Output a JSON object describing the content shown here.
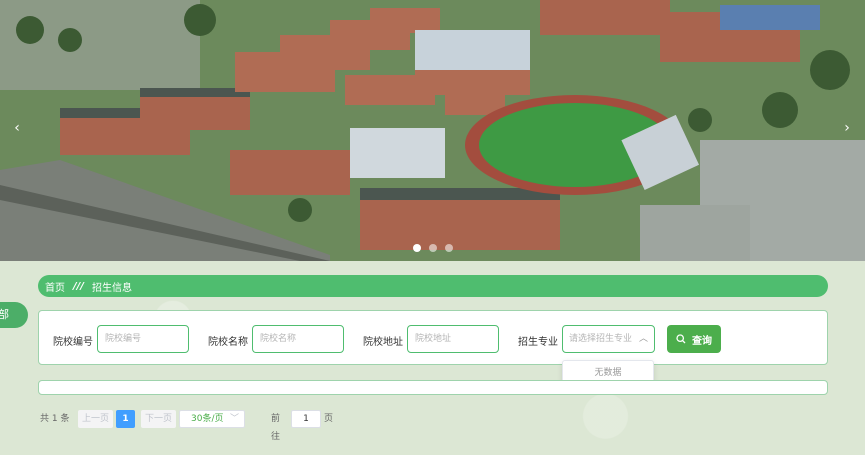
{
  "banner": {
    "prev_arrow": "‹",
    "next_arrow": "›",
    "dots": 3,
    "active_dot": 0
  },
  "side_tab": {
    "label": "部"
  },
  "breadcrumb": {
    "home": "首页",
    "separator": "///",
    "current": "招生信息"
  },
  "search": {
    "school_code_label": "院校编号",
    "school_code_placeholder": "院校编号",
    "school_name_label": "院校名称",
    "school_name_placeholder": "院校名称",
    "school_addr_label": "院校地址",
    "school_addr_placeholder": "院校地址",
    "major_label": "招生专业",
    "major_placeholder": "请选择招生专业",
    "query_button": "查询",
    "dropdown_empty": "无数据"
  },
  "pagination": {
    "total": "共 1 条",
    "prev": "上一页",
    "current_page": "1",
    "next": "下一页",
    "page_size": "30条/页",
    "goto": "前往",
    "jump_value": "1",
    "page_suffix": "页"
  },
  "colors": {
    "accent": "#4fbd6f",
    "button": "#4cae4c",
    "page_active": "#409eff"
  }
}
